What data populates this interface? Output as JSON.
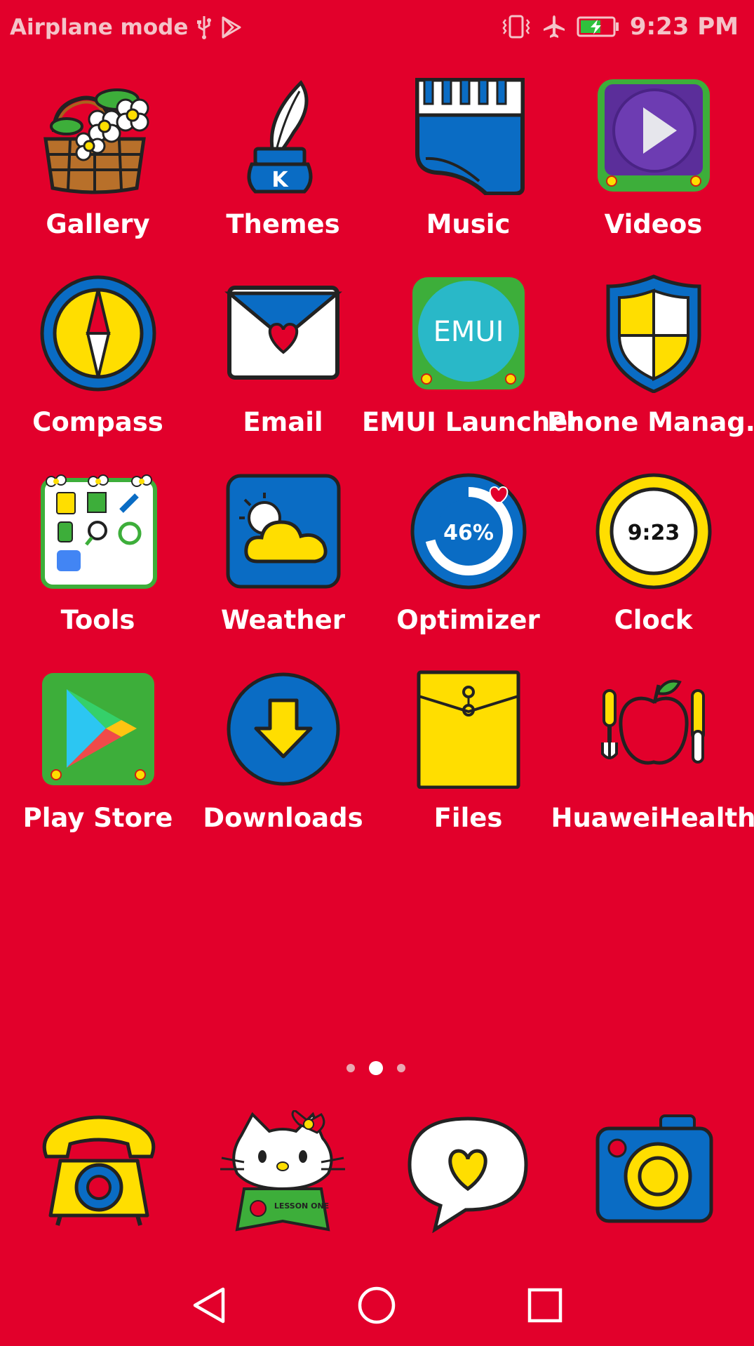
{
  "status_bar": {
    "mode_text": "Airplane mode",
    "time": "9:23 PM",
    "left_icons": [
      "usb-icon",
      "play-store-notification-icon"
    ],
    "right_icons": [
      "vibrate-icon",
      "airplane-icon",
      "battery-charging-icon"
    ]
  },
  "apps": [
    {
      "label": "Gallery",
      "icon": "gallery-basket-icon"
    },
    {
      "label": "Themes",
      "icon": "themes-quill-icon"
    },
    {
      "label": "Music",
      "icon": "music-piano-icon"
    },
    {
      "label": "Videos",
      "icon": "videos-play-icon"
    },
    {
      "label": "Compass",
      "icon": "compass-icon"
    },
    {
      "label": "Email",
      "icon": "email-envelope-icon"
    },
    {
      "label": "EMUI Launcher",
      "icon": "emui-launcher-icon",
      "icon_text": "EMUI"
    },
    {
      "label": "Phone Manag..",
      "icon": "phone-manager-shield-icon"
    },
    {
      "label": "Tools",
      "icon": "tools-folder-icon"
    },
    {
      "label": "Weather",
      "icon": "weather-cloud-icon"
    },
    {
      "label": "Optimizer",
      "icon": "optimizer-gauge-icon",
      "icon_text": "46%"
    },
    {
      "label": "Clock",
      "icon": "clock-icon",
      "icon_text": "9:23"
    },
    {
      "label": "Play Store",
      "icon": "play-store-icon"
    },
    {
      "label": "Downloads",
      "icon": "downloads-arrow-icon"
    },
    {
      "label": "Files",
      "icon": "files-envelope-icon"
    },
    {
      "label": "HuaweiHealth",
      "icon": "health-apple-icon"
    }
  ],
  "pagination": {
    "pages": 3,
    "current": 2
  },
  "dock": [
    {
      "name": "phone",
      "icon": "phone-telephone-icon"
    },
    {
      "name": "contacts",
      "icon": "hello-kitty-contacts-icon",
      "icon_text": "LESSON ONE"
    },
    {
      "name": "messages",
      "icon": "messages-heart-bubble-icon"
    },
    {
      "name": "camera",
      "icon": "camera-icon"
    }
  ],
  "nav_bar": {
    "buttons": [
      "back-icon",
      "home-icon",
      "recents-icon"
    ]
  },
  "colors": {
    "background": "#E2002B",
    "blue": "#0A6CC4",
    "yellow": "#FFDE00",
    "green": "#3DAE3A"
  }
}
